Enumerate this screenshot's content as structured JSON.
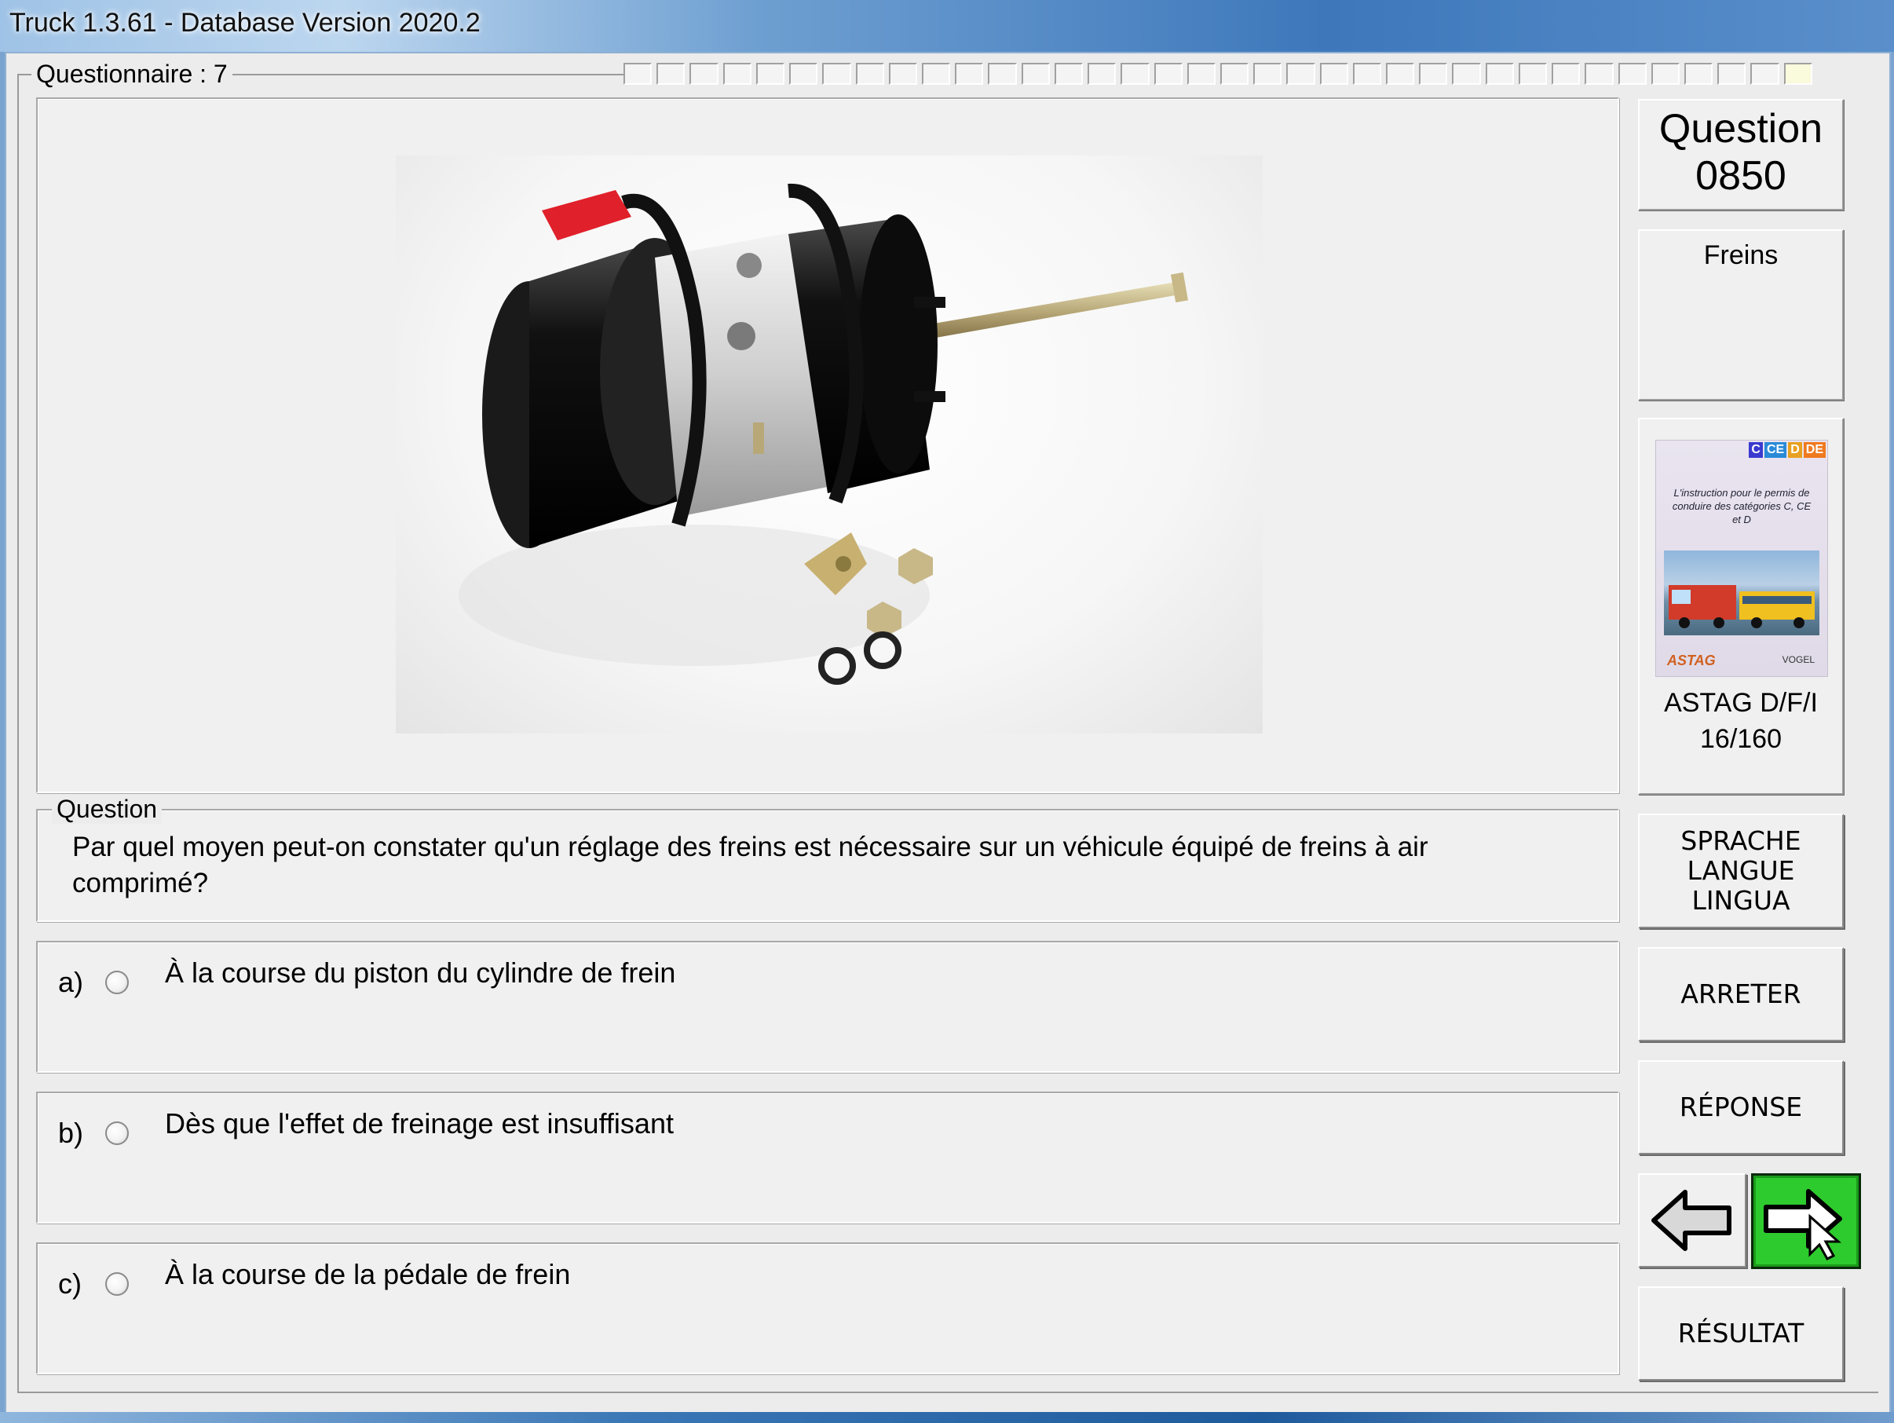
{
  "window": {
    "title": "Truck 1.3.61 - Database Version 2020.2"
  },
  "questionnaire": {
    "label": "Questionnaire : 7",
    "progress_total": 36,
    "progress_current": 36
  },
  "question_panel": {
    "heading_line1": "Question",
    "heading_line2": "0850",
    "topic": "Freins"
  },
  "book": {
    "badges": [
      "C",
      "CE",
      "D",
      "DE"
    ],
    "badge_colors": [
      "#3a3ad0",
      "#2a8ad8",
      "#e8a020",
      "#f07a20"
    ],
    "cover_text": "L'instruction pour le permis de conduire des catégories C, CE et D",
    "logo_left": "ASTAG",
    "logo_right": "VOGEL",
    "caption_line1": "ASTAG D/F/I",
    "caption_line2": "16/160"
  },
  "question": {
    "label": "Question",
    "text": "Par quel moyen peut-on constater qu'un réglage des freins est nécessaire sur un véhicule équipé de freins à air comprimé?"
  },
  "answers": [
    {
      "letter": "a)",
      "text": "À la course du piston du cylindre de frein",
      "selected": false
    },
    {
      "letter": "b)",
      "text": "Dès que l'effet de freinage est insuffisant",
      "selected": false
    },
    {
      "letter": "c)",
      "text": "À la course de la pédale de frein",
      "selected": false
    }
  ],
  "buttons": {
    "language_line1": "SPRACHE",
    "language_line2": "LANGUE",
    "language_line3": "LINGUA",
    "stop": "ARRETER",
    "answer": "RÉPONSE",
    "result": "RÉSULTAT",
    "prev_icon": "arrow-left-icon",
    "next_icon": "arrow-right-icon",
    "next_color": "#2ecb2e"
  }
}
